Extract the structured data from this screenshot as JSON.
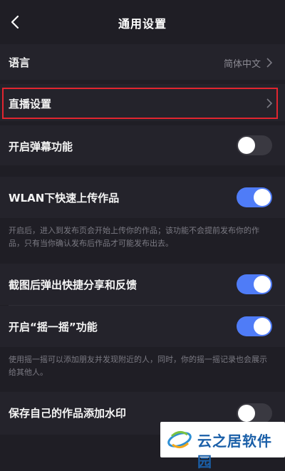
{
  "header": {
    "title": "通用设置"
  },
  "settings": {
    "language": {
      "label": "语言",
      "value": "简体中文"
    },
    "live": {
      "label": "直播设置"
    },
    "danmaku": {
      "label": "开启弹幕功能",
      "enabled": false
    },
    "wlan": {
      "label": "WLAN下快速上传作品",
      "enabled": true,
      "desc": "开启后，进入到发布页会开始上传你的作品；该功能不会提前发布你的作品，只有当你确认发布后作品才可能发布出去。"
    },
    "screenshot": {
      "label": "截图后弹出快捷分享和反馈",
      "enabled": true
    },
    "shake": {
      "label": "开启“摇一摇”功能",
      "enabled": true,
      "desc": "使用摇一摇可以添加朋友并发现附近的人，同时，你的摇一摇记录也会展示给其他人。"
    },
    "watermark": {
      "label": "保存自己的作品添加水印",
      "enabled": false
    }
  },
  "watermark_logo": {
    "text": "云之居软件园"
  },
  "colors": {
    "accent": "#4f7cf7",
    "highlight": "#e1252f",
    "background": "#1f1e25"
  }
}
